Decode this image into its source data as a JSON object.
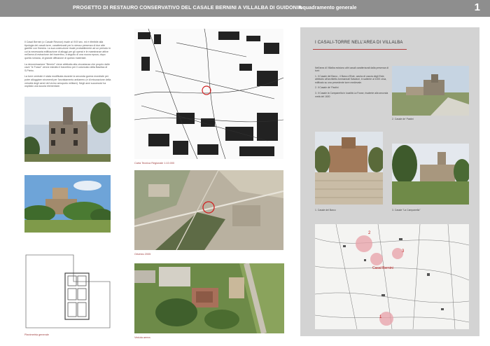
{
  "header": {
    "title": "PROGETTO DI RESTAURO CONSERVATIVO DEL CASALE BERNINI A VILLALBA DI GUIDONIA",
    "section": "Inquadramento generale",
    "page_number": "1"
  },
  "intro": {
    "paragraphs": [
      "Il Casal Bernini (o Casale Reunon) risale al XVII sec. ed è riferibile alla tipologia dei casali-torre, caratterizzati per lo stesso presenza di due alte garritte con finestra. La sua costruzione risale probabilmente ad un periodo in cui la necessaria edificazione di alloggi per gli operai e le maestranze attive nell'area di estrazione del travertino, a seguito di una nuova epoca, dopo quella romana, di grande diffusione di questo materiale.",
      "La denominazione \"Bernini\" viene attribuita alla circostanza che proprio dalle cave \"le Fosse\" venne estratto il travertino per il colonnato della Basilica di S.Pietro.",
      "La torre centrale è stata modificata durante la seconda guerra mondiale per poter alloggiare strumenti per l'avvistamento antiaereo (e di misurazione della velocità degli aerei del vicino aeroporto militare). Negli anni successivi ha ospitato una scuola elementare."
    ]
  },
  "captions": {
    "plan": "Planimetria generale",
    "ctr": "Carta Tecnica Regionale 1:10.000",
    "ortho": "Ortofoto 2005",
    "aerial": "Veduta aerea"
  },
  "panel": {
    "title": "I CASALI-TORRE NELL'AREA DI VILLALBA",
    "paragraphs": [
      "Nell'area di Villalba esistono altri casali caratterizzati dalla presenza di torri:",
      "1. Il Casale del Barco - il Barco d'Este, casino di caccia degli Este, attribuito all'architetto Ammannati Salvatori, in saliente al 1000 circa, edificato su una precedente torre medievale.",
      "2. Il Casale de' Pastini",
      "3. Il Casale la Campanella in località La Fosse, risalente alla seconda metà del 1600"
    ],
    "captions": {
      "pastini": "2. Casale de' Pastini",
      "barco": "1. Casale del Barco",
      "campanella": "3. Casale \"La Campanella\""
    },
    "map_labels": {
      "bernini": "Casal Bernini",
      "n1": "1",
      "n2": "2",
      "n3": "3"
    }
  },
  "colors": {
    "header": "#8e8e8e",
    "panel": "#d3d3d3",
    "accent": "#b34040"
  }
}
